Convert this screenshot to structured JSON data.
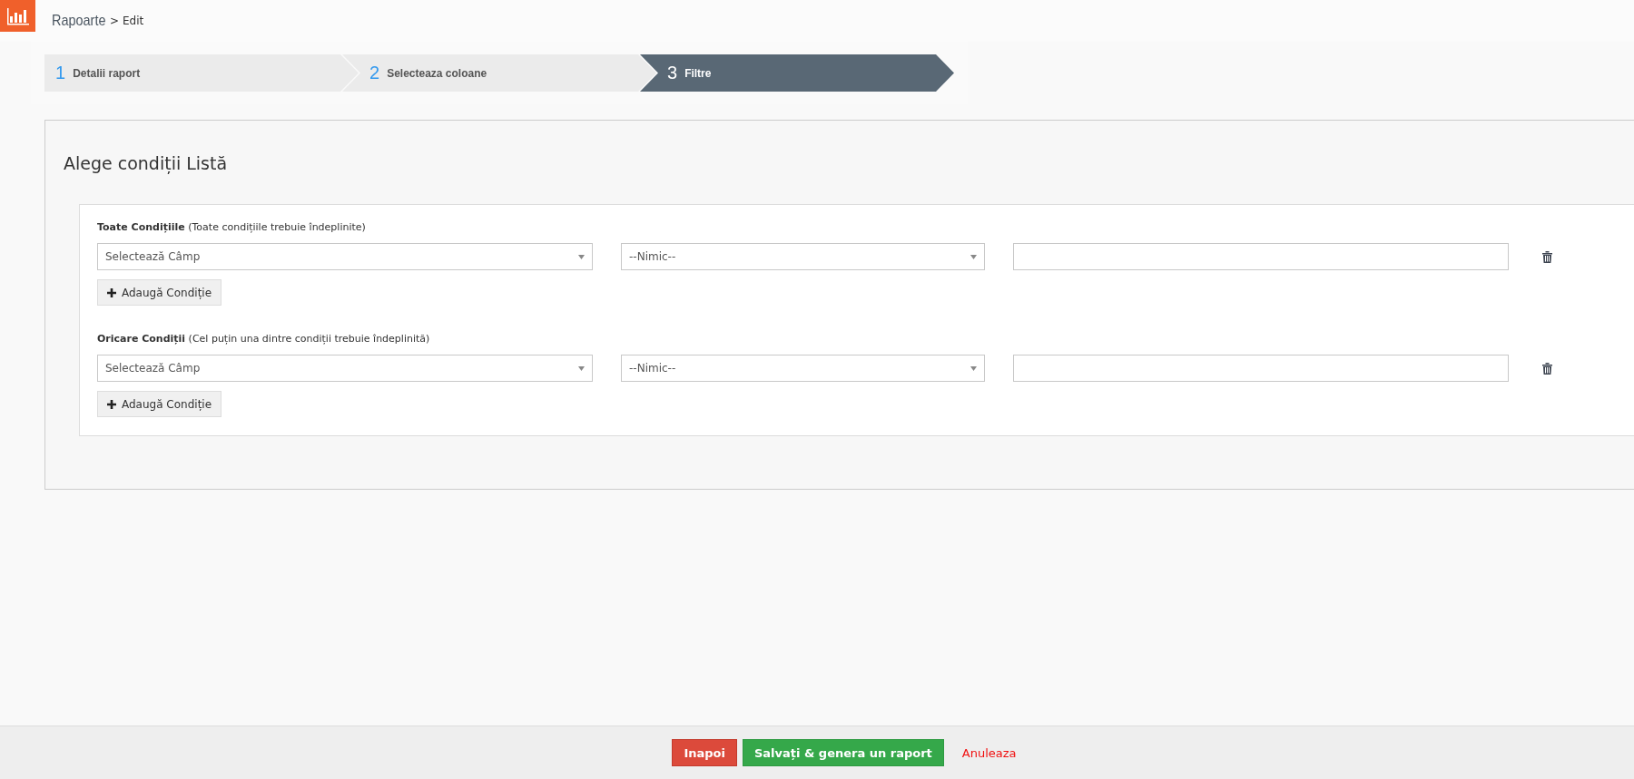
{
  "header": {
    "title": "Rapoarte",
    "separator": ">",
    "page": "Edit"
  },
  "steps": [
    {
      "number": "1",
      "label": "Detalii raport",
      "selected": false
    },
    {
      "number": "2",
      "label": "Selecteaza coloane",
      "selected": false
    },
    {
      "number": "3",
      "label": "Filtre",
      "selected": true
    }
  ],
  "panel": {
    "title": "Alege condiții Listă",
    "groups": [
      {
        "title": "Toate Condițiile",
        "hint": "(Toate condițiile trebuie îndeplinite)",
        "conditions": [
          {
            "field": "Selectează Câmp",
            "operator": "--Nimic--"
          }
        ],
        "add_button": "Adaugă Condiție"
      },
      {
        "title": "Oricare Condiții",
        "hint": "(Cel puțin una dintre condiții trebuie îndeplinită)",
        "conditions": [
          {
            "field": "Selectează Câmp",
            "operator": "--Nimic--"
          }
        ],
        "add_button": "Adaugă Condiție"
      }
    ]
  },
  "footer": {
    "back": "Inapoi",
    "save": "Salvați & genera un raport",
    "cancel": "Anuleaza"
  }
}
